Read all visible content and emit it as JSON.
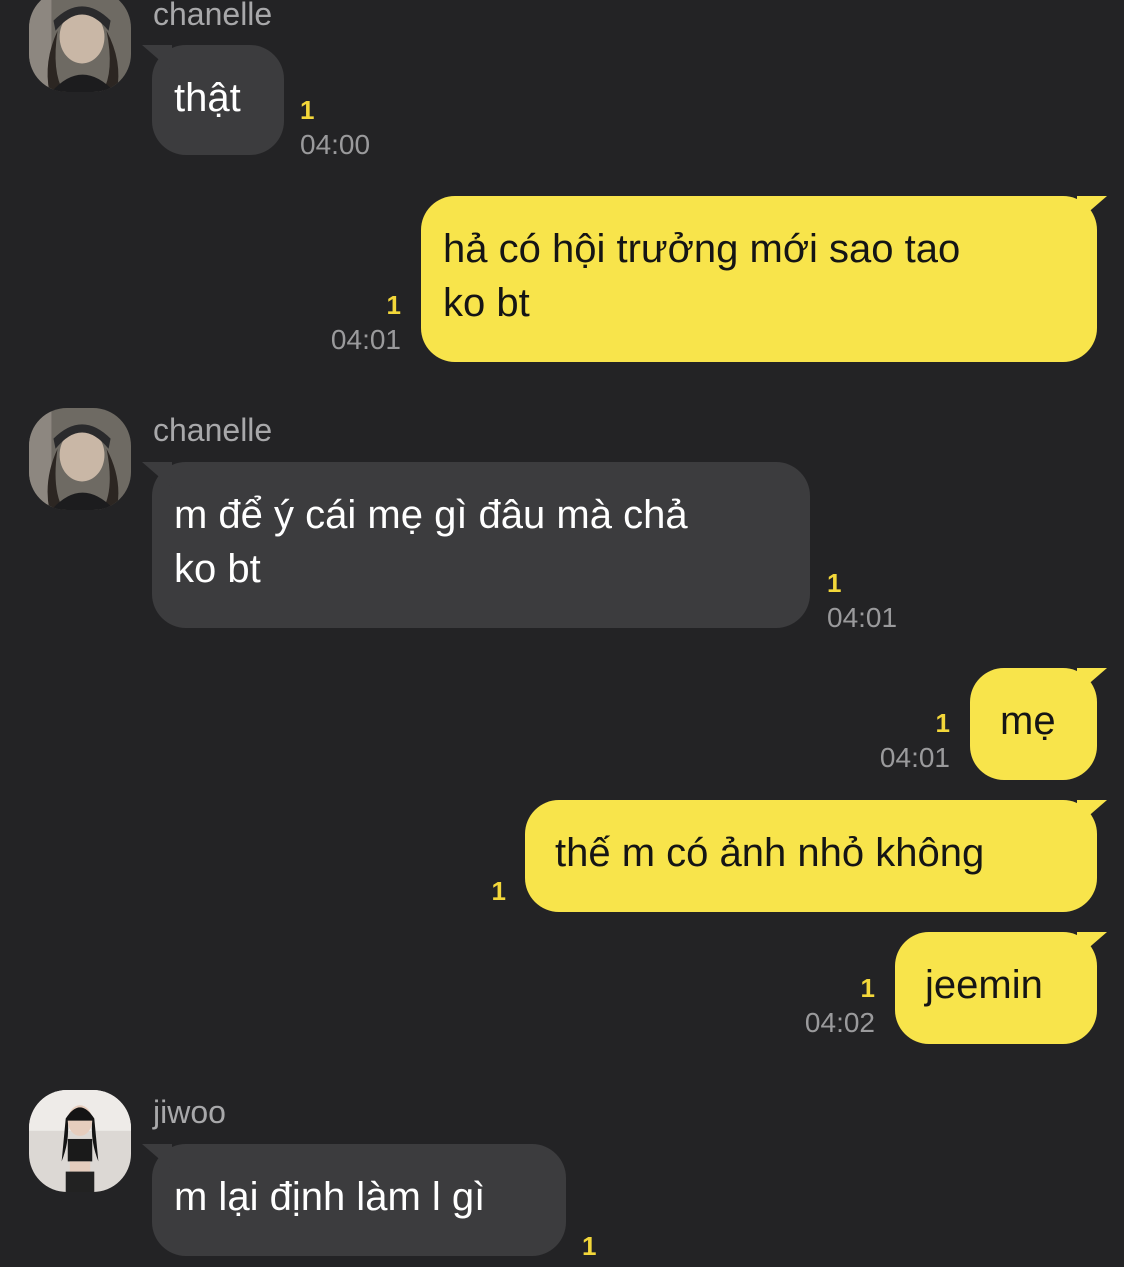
{
  "colors": {
    "background": "#232325",
    "incoming_bubble": "#3c3c3e",
    "outgoing_bubble": "#f8e44b",
    "unread_count": "#f3d73a",
    "timestamp": "#9a9a9c",
    "sender_name": "#a8a8aa"
  },
  "messages": [
    {
      "sender": "chanelle",
      "text": "thật",
      "unread": "1",
      "time": "04:00"
    },
    {
      "sender": "me",
      "text_lines": [
        "hả có hội trưởng mới sao tao",
        "ko bt"
      ],
      "unread": "1",
      "time": "04:01"
    },
    {
      "sender": "chanelle",
      "text_lines": [
        "m để ý cái mẹ gì đâu mà chả",
        "ko bt"
      ],
      "unread": "1",
      "time": "04:01"
    },
    {
      "sender": "me",
      "text": "mẹ",
      "unread": "1",
      "time": "04:01"
    },
    {
      "sender": "me",
      "text": "thế m có ảnh nhỏ không",
      "unread": "1"
    },
    {
      "sender": "me",
      "text": "jeemin",
      "unread": "1",
      "time": "04:02"
    },
    {
      "sender": "jiwoo",
      "text": "m lại định làm l gì",
      "unread": "1"
    }
  ]
}
